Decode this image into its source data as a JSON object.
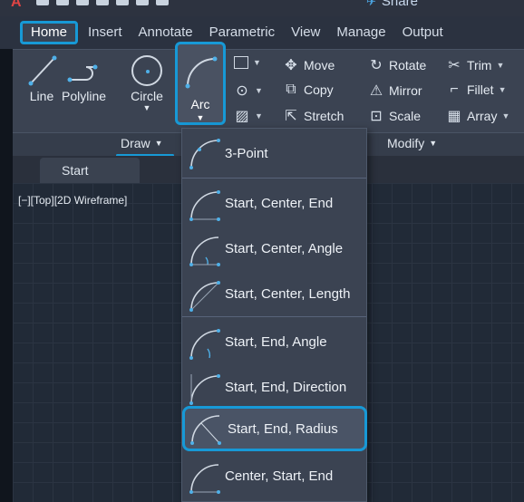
{
  "titlebar": {
    "share_label": "Share"
  },
  "tabs": [
    {
      "label": "Home",
      "active": true
    },
    {
      "label": "Insert"
    },
    {
      "label": "Annotate"
    },
    {
      "label": "Parametric"
    },
    {
      "label": "View"
    },
    {
      "label": "Manage"
    },
    {
      "label": "Output"
    }
  ],
  "draw_panel": {
    "tools": {
      "line": "Line",
      "polyline": "Polyline",
      "circle": "Circle",
      "arc": "Arc"
    },
    "title": "Draw"
  },
  "modify_panel": {
    "move": "Move",
    "copy": "Copy",
    "stretch": "Stretch",
    "rotate": "Rotate",
    "mirror": "Mirror",
    "scale": "Scale",
    "trim": "Trim",
    "fillet": "Fillet",
    "array": "Array",
    "title": "Modify"
  },
  "file_tab": {
    "label": "Start"
  },
  "viewport": {
    "label": "[−][Top][2D Wireframe]"
  },
  "arc_menu": {
    "items": [
      {
        "label": "3-Point",
        "icon": "arc-3point-icon"
      },
      {
        "label": "Start, Center, End",
        "icon": "arc-start-center-end-icon"
      },
      {
        "label": "Start, Center, Angle",
        "icon": "arc-start-center-angle-icon"
      },
      {
        "label": "Start, Center, Length",
        "icon": "arc-start-center-length-icon"
      },
      {
        "label": "Start, End, Angle",
        "icon": "arc-start-end-angle-icon"
      },
      {
        "label": "Start, End, Direction",
        "icon": "arc-start-end-direction-icon"
      },
      {
        "label": "Start, End, Radius",
        "icon": "arc-start-end-radius-icon",
        "highlighted": true
      },
      {
        "label": "Center, Start, End",
        "icon": "arc-center-start-end-icon"
      }
    ]
  },
  "colors": {
    "accent": "#1799d6",
    "ribbon": "#3b4352",
    "canvas": "#212a37",
    "point": "#4fb0e8"
  }
}
